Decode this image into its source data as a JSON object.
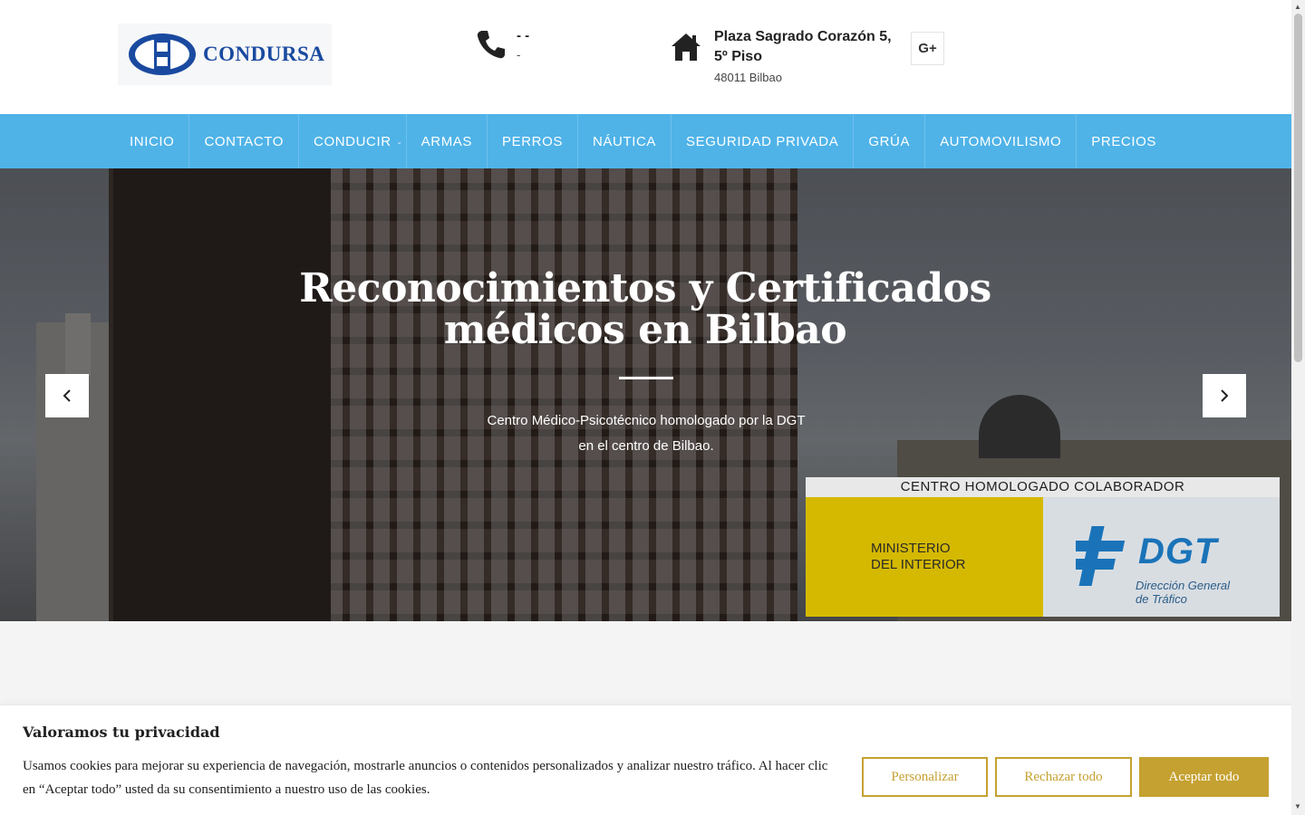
{
  "brand": {
    "name": "CONDURSA",
    "logo_color": "#1a4aa0"
  },
  "header": {
    "phone": {
      "line1": "- -",
      "line2": "-",
      "icon": "phone-icon"
    },
    "address": {
      "line1": "Plaza Sagrado Corazón 5, 5º Piso",
      "line2": "48011 Bilbao",
      "icon": "home-icon"
    },
    "social": {
      "label": "G+",
      "icon": "google-plus-icon"
    }
  },
  "nav": {
    "color": "#4fb3e8",
    "items": [
      {
        "label": "INICIO"
      },
      {
        "label": "CONTACTO"
      },
      {
        "label": "CONDUCIR",
        "has_submenu": true
      },
      {
        "label": "ARMAS"
      },
      {
        "label": "PERROS"
      },
      {
        "label": "NÁUTICA"
      },
      {
        "label": "SEGURIDAD PRIVADA"
      },
      {
        "label": "GRÚA"
      },
      {
        "label": "AUTOMOVILISMO"
      },
      {
        "label": "PRECIOS"
      }
    ]
  },
  "hero": {
    "title": "Reconocimientos y Certificados médicos en Bilbao",
    "subtitle_line1": "Centro Médico-Psicotécnico homologado por la DGT",
    "subtitle_line2": "en el centro de Bilbao.",
    "sign": {
      "title": "CENTRO HOMOLOGADO COLABORADOR",
      "ministry": "MINISTERIO\nDEL INTERIOR",
      "dgt": "DGT",
      "dgt_sub": "Dirección General\nde Tráfico"
    },
    "prev_icon": "chevron-left-icon",
    "next_icon": "chevron-right-icon"
  },
  "cookie": {
    "title": "Valoramos tu privacidad",
    "text": "Usamos cookies para mejorar su experiencia de navegación, mostrarle anuncios o contenidos personalizados y analizar nuestro tráfico. Al hacer clic en “Aceptar todo” usted da su consentimiento a nuestro uso de las cookies.",
    "customize": "Personalizar",
    "reject": "Rechazar todo",
    "accept": "Aceptar todo",
    "accent": "#c5a131"
  }
}
